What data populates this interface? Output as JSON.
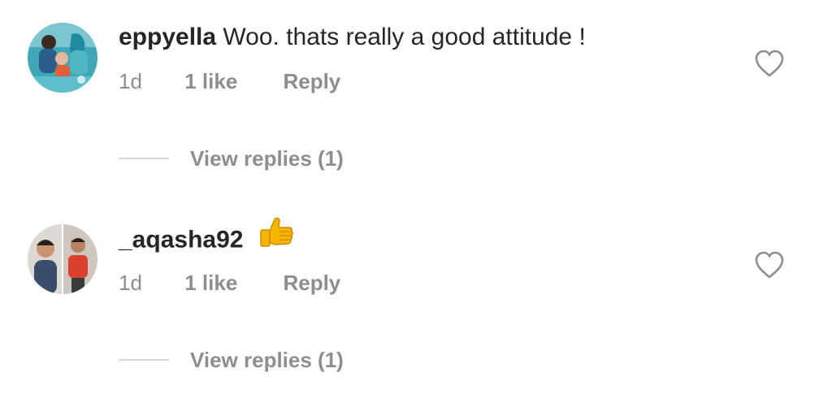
{
  "comments": [
    {
      "username": "eppyella",
      "text": "Woo. thats really a good attitude !",
      "time": "1d",
      "likes": "1 like",
      "reply_label": "Reply",
      "view_replies_label": "View replies (1)",
      "avatar_icon": "avatar-photo-icon",
      "like_icon": "heart-outline-icon"
    },
    {
      "username": "_aqasha92",
      "text": "",
      "emoji": "thumbs-up-emoji",
      "time": "1d",
      "likes": "1 like",
      "reply_label": "Reply",
      "view_replies_label": "View replies (1)",
      "avatar_icon": "avatar-photo-icon",
      "like_icon": "heart-outline-icon"
    }
  ],
  "colors": {
    "primary_text": "#262626",
    "secondary_text": "#8e8e8e",
    "divider_line": "#d6d6d6",
    "emoji_yellow": "#f7b500"
  }
}
